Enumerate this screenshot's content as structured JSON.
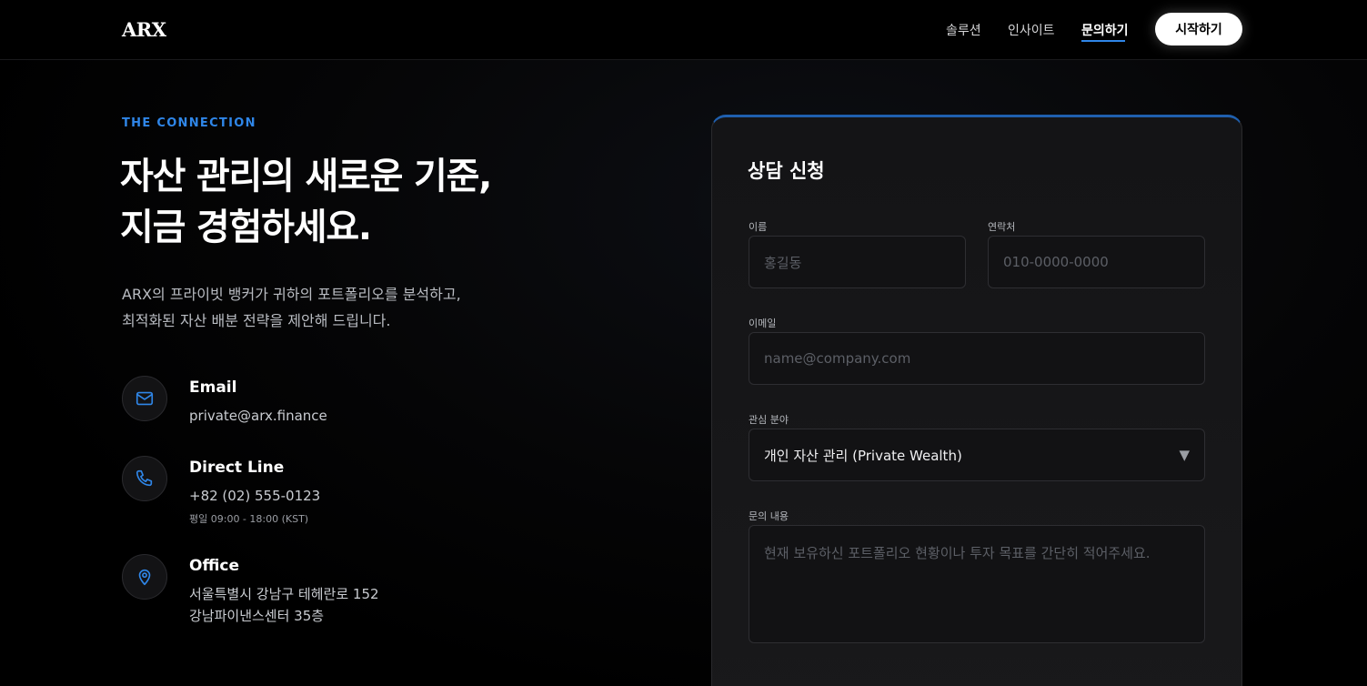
{
  "header": {
    "logo": "ARX",
    "nav": [
      "솔루션",
      "인사이트",
      "문의하기"
    ],
    "active_nav": "문의하기",
    "cta": "시작하기",
    "accent": "#2f86e8"
  },
  "hero": {
    "eyebrow": "THE CONNECTION",
    "headline_line1": "자산 관리의 새로운 기준,",
    "headline_line2": "지금 경험하세요.",
    "desc_line1": "ARX의 프라이빗 뱅커가 귀하의 포트폴리오를 분석하고,",
    "desc_line2": "최적화된 자산 배분 전략을 제안해 드립니다."
  },
  "contacts": [
    {
      "icon": "mail-icon",
      "title": "Email",
      "value": "private@arx.finance"
    },
    {
      "icon": "phone-icon",
      "title": "Direct Line",
      "value": "+82 (02) 555-0123",
      "sub": "평일 09:00 - 18:00 (KST)"
    },
    {
      "icon": "location-pin-icon",
      "title": "Office",
      "value_line1": "서울특별시 강남구 테헤란로 152",
      "value_line2": "강남파이낸스센터 35층"
    }
  ],
  "form": {
    "title": "상담 신청",
    "name_label": "이름",
    "name_placeholder": "홍길동",
    "phone_label": "연락처",
    "phone_placeholder": "010-0000-0000",
    "email_label": "이메일",
    "email_placeholder": "name@company.com",
    "interest_label": "관심 분야",
    "interest_selected": "개인 자산 관리 (Private Wealth)",
    "message_label": "문의 내용",
    "message_placeholder": "현재 보유하신 포트폴리오 현황이나 투자 목표를 간단히 적어주세요."
  }
}
